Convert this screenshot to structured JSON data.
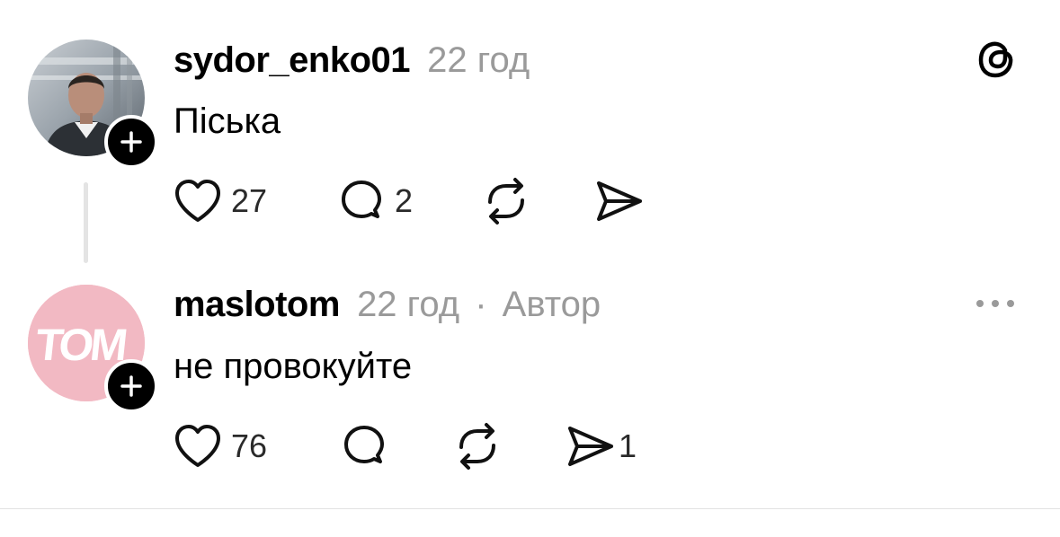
{
  "posts": [
    {
      "username": "sydor_enko01",
      "time": "22 год",
      "text": "Піська",
      "likes": "27",
      "replies": "2",
      "reposts": "",
      "shares": "",
      "top_right_icon": "threads-logo-icon"
    },
    {
      "username": "maslotom",
      "time": "22 год",
      "separator": "·",
      "author_badge": "Автор",
      "text": "не провокуйте",
      "likes": "76",
      "replies": "",
      "reposts": "",
      "shares": "1",
      "top_right_icon": "more-options-icon",
      "avatar_text": "TOM"
    }
  ],
  "colors": {
    "meta_gray": "#9a9a9a",
    "avatar_pink": "#f2b9c3",
    "thread_line": "#e4e4e4"
  }
}
